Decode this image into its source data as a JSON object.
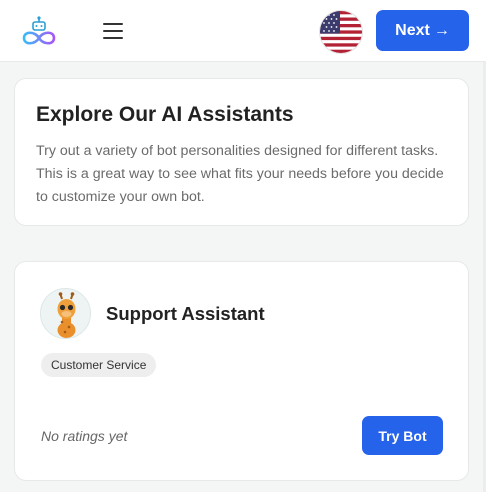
{
  "header": {
    "logo_icon": "infinity-robot-logo-icon",
    "menu_icon": "hamburger-menu-icon",
    "language_icon": "us-flag-icon",
    "next_label": "Next",
    "next_arrow": "→"
  },
  "intro": {
    "title": "Explore Our AI Assistants",
    "description": "Try out a variety of bot personalities designed for different tasks. This is a great way to see what fits your needs before you decide to customize your own bot."
  },
  "bots": [
    {
      "name": "Support Assistant",
      "avatar_icon": "giraffe-avatar-icon",
      "tag": "Customer Service",
      "rating_text": "No ratings yet",
      "try_label": "Try Bot"
    }
  ],
  "colors": {
    "primary": "#2563eb",
    "logo_gradient": [
      "#38bdf8",
      "#a855f7"
    ],
    "page_bg": "#f4f6f6"
  }
}
